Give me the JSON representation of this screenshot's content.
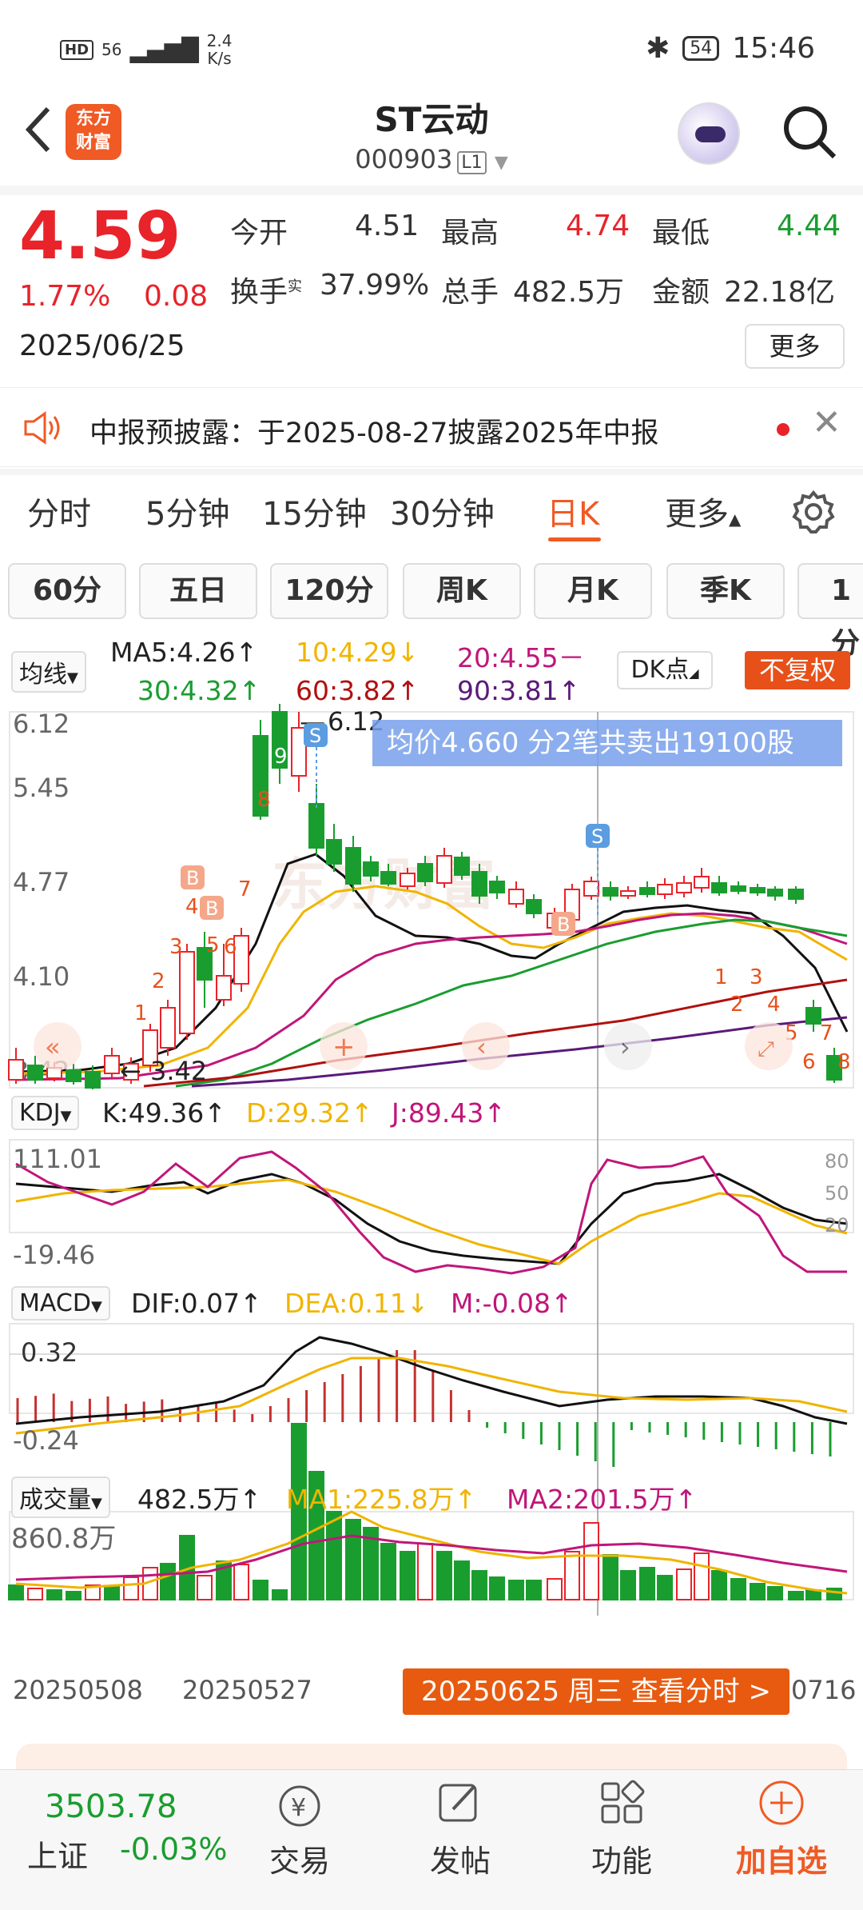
{
  "status_bar": {
    "network": "HD",
    "signal": "56",
    "speed": "2.4",
    "speed_unit": "K/s",
    "battery": "54",
    "time": "15:46"
  },
  "header": {
    "name": "ST云动",
    "code": "000903",
    "level": "L1",
    "logo_line1": "东方",
    "logo_line2": "财富"
  },
  "quote": {
    "price": "4.59",
    "change_pct": "1.77%",
    "change": "0.08",
    "date": "2025/06/25",
    "open_label": "今开",
    "open": "4.51",
    "high_label": "最高",
    "high": "4.74",
    "low_label": "最低",
    "low": "4.44",
    "turnover_label": "换手",
    "turnover_sup": "实",
    "turnover": "37.99%",
    "volume_label": "总手",
    "volume": "482.5万",
    "amount_label": "金额",
    "amount": "22.18亿",
    "more": "更多"
  },
  "notice": {
    "text": "中报预披露：于2025-08-27披露2025年中报"
  },
  "tabs": [
    "分时",
    "5分钟",
    "15分钟",
    "30分钟",
    "日K",
    "更多"
  ],
  "periods": [
    "60分",
    "五日",
    "120分",
    "周K",
    "月K",
    "季K",
    "1分"
  ],
  "ma": {
    "selector": "均线",
    "ma5": "MA5:4.26↑",
    "ma10": "10:4.29↓",
    "ma20": "20:4.55－",
    "ma30": "30:4.32↑",
    "ma60": "60:3.82↑",
    "ma90": "90:3.81↑",
    "dk": "DK点",
    "fq": "不复权"
  },
  "kline": {
    "y_labels": [
      "6.12",
      "5.45",
      "4.77",
      "4.10",
      "3.42"
    ],
    "high_label": "6.12",
    "low_label": "3.42",
    "avg_tip": "均价4.660  分2笔共卖出19100股",
    "numbers": [
      "1",
      "2",
      "3",
      "4",
      "5",
      "6",
      "7",
      "8",
      "9",
      "1",
      "2",
      "3",
      "4",
      "5",
      "6",
      "7",
      "8"
    ]
  },
  "kdj": {
    "selector": "KDJ",
    "k": "K:49.36↑",
    "d": "D:29.32↑",
    "j": "J:89.43↑",
    "top": "111.01",
    "bottom": "-19.46",
    "r1": "80",
    "r2": "50",
    "r3": "20"
  },
  "macd": {
    "selector": "MACD",
    "dif": "DIF:0.07↑",
    "dea": "DEA:0.11↓",
    "m": "M:-0.08↑",
    "top": "0.32",
    "bottom": "-0.24"
  },
  "vol": {
    "selector": "成交量",
    "v": "482.5万↑",
    "ma1": "MA1:225.8万↑",
    "ma2": "MA2:201.5万↑",
    "top": "860.8万"
  },
  "x_axis": {
    "d1": "20250508",
    "d2": "20250527",
    "d3": "0716"
  },
  "tip": "20250625 周三 查看分时 >",
  "bottom": {
    "index_value": "3503.78",
    "index_name": "上证",
    "index_change": "-0.03%",
    "trade": "交易",
    "post": "发帖",
    "func": "功能",
    "add": "加自选"
  },
  "colors": {
    "up": "#e8232a",
    "down": "#1a9d2f",
    "accent": "#f05a24"
  }
}
